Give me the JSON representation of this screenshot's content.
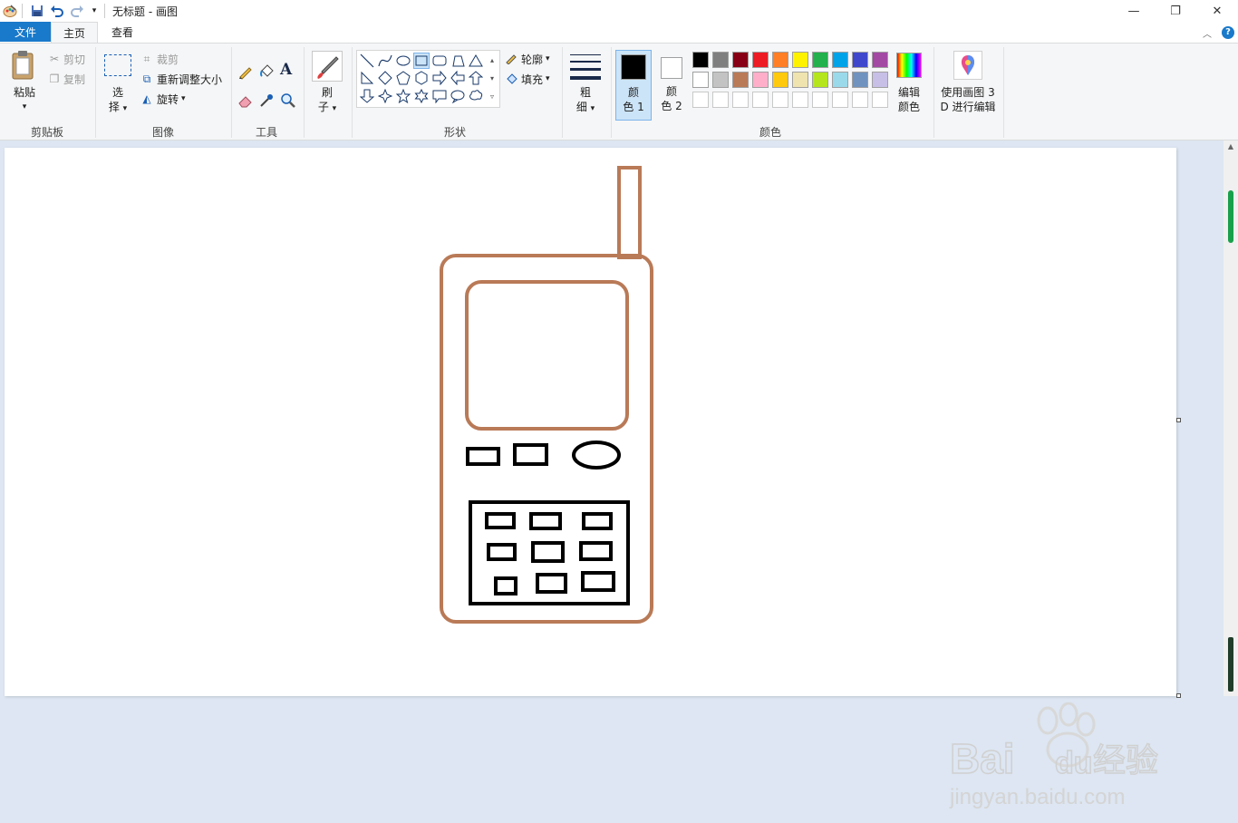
{
  "window": {
    "title": "无标题 - 画图",
    "controls": {
      "minimize": "—",
      "maximize": "❐",
      "close": "✕"
    }
  },
  "tabs": {
    "file": "文件",
    "home": "主页",
    "view": "查看"
  },
  "clipboard": {
    "paste": "粘贴",
    "cut": "剪切",
    "copy": "复制",
    "group": "剪贴板"
  },
  "image": {
    "select_1": "选",
    "select_2": "择",
    "crop": "裁剪",
    "resize": "重新调整大小",
    "rotate": "旋转",
    "group": "图像"
  },
  "tools": {
    "group": "工具",
    "text_glyph": "A"
  },
  "brushes": {
    "label_1": "刷",
    "label_2": "子"
  },
  "shapes": {
    "outline": "轮廓",
    "fill": "填充",
    "group": "形状"
  },
  "size": {
    "label_1": "粗",
    "label_2": "细"
  },
  "colors": {
    "color1_1": "颜",
    "color1_2": "色 1",
    "color2_1": "颜",
    "color2_2": "色 2",
    "edit_1": "编辑",
    "edit_2": "颜色",
    "group": "颜色",
    "color1": "#000000",
    "color2": "#ffffff",
    "palette_row1": [
      "#000000",
      "#7f7f7f",
      "#880015",
      "#ed1c24",
      "#ff7f27",
      "#fff200",
      "#22b14c",
      "#00a2e8",
      "#3f48cc",
      "#a349a4"
    ],
    "palette_row2": [
      "#ffffff",
      "#c3c3c3",
      "#b97a57",
      "#ffaec9",
      "#ffc90e",
      "#efe4b0",
      "#b5e61d",
      "#99d9ea",
      "#7092be",
      "#c8bfe7"
    ],
    "palette_row3": [
      "#ffffff",
      "#ffffff",
      "#ffffff",
      "#ffffff",
      "#ffffff",
      "#ffffff",
      "#ffffff",
      "#ffffff",
      "#ffffff",
      "#ffffff"
    ]
  },
  "paint3d": {
    "label_1": "使用画图 3",
    "label_2": "D 进行编辑"
  },
  "drawing": {
    "outline_color": "#b97a57",
    "keypad_color": "#000000"
  },
  "watermark": {
    "brand_left": "Bai",
    "brand_right": "du",
    "brand_cn": "经验",
    "url": "jingyan.baidu.com"
  }
}
